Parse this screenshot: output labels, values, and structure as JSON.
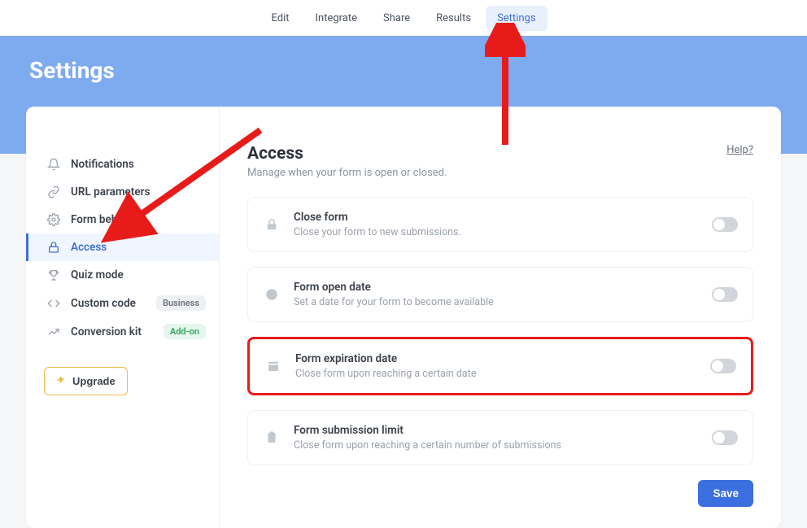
{
  "topnav": {
    "items": [
      {
        "label": "Edit"
      },
      {
        "label": "Integrate"
      },
      {
        "label": "Share"
      },
      {
        "label": "Results"
      },
      {
        "label": "Settings"
      }
    ],
    "activeIndex": 4
  },
  "hero": {
    "title": "Settings"
  },
  "sidebar": {
    "items": [
      {
        "label": "Notifications"
      },
      {
        "label": "URL parameters"
      },
      {
        "label": "Form behavior"
      },
      {
        "label": "Access"
      },
      {
        "label": "Quiz mode"
      },
      {
        "label": "Custom code",
        "badge": "Business",
        "badgeKind": "business"
      },
      {
        "label": "Conversion kit",
        "badge": "Add-on",
        "badgeKind": "addon"
      }
    ],
    "activeIndex": 3,
    "upgrade_label": "Upgrade"
  },
  "main": {
    "title": "Access",
    "subtitle": "Manage when your form is open or closed.",
    "help_label": "Help?",
    "cards": [
      {
        "title": "Close form",
        "desc": "Close your form to new submissions.",
        "on": false
      },
      {
        "title": "Form open date",
        "desc": "Set a date for your form to become available",
        "on": false
      },
      {
        "title": "Form expiration date",
        "desc": "Close form upon reaching a certain date",
        "on": false,
        "highlight": true
      },
      {
        "title": "Form submission limit",
        "desc": "Close form upon reaching a certain number of submissions",
        "on": false
      }
    ],
    "save_label": "Save"
  },
  "annotations": {
    "arrow_to_settings": true,
    "arrow_to_access": true,
    "highlight_card_index": 2,
    "arrow_color": "#e81b1b"
  }
}
